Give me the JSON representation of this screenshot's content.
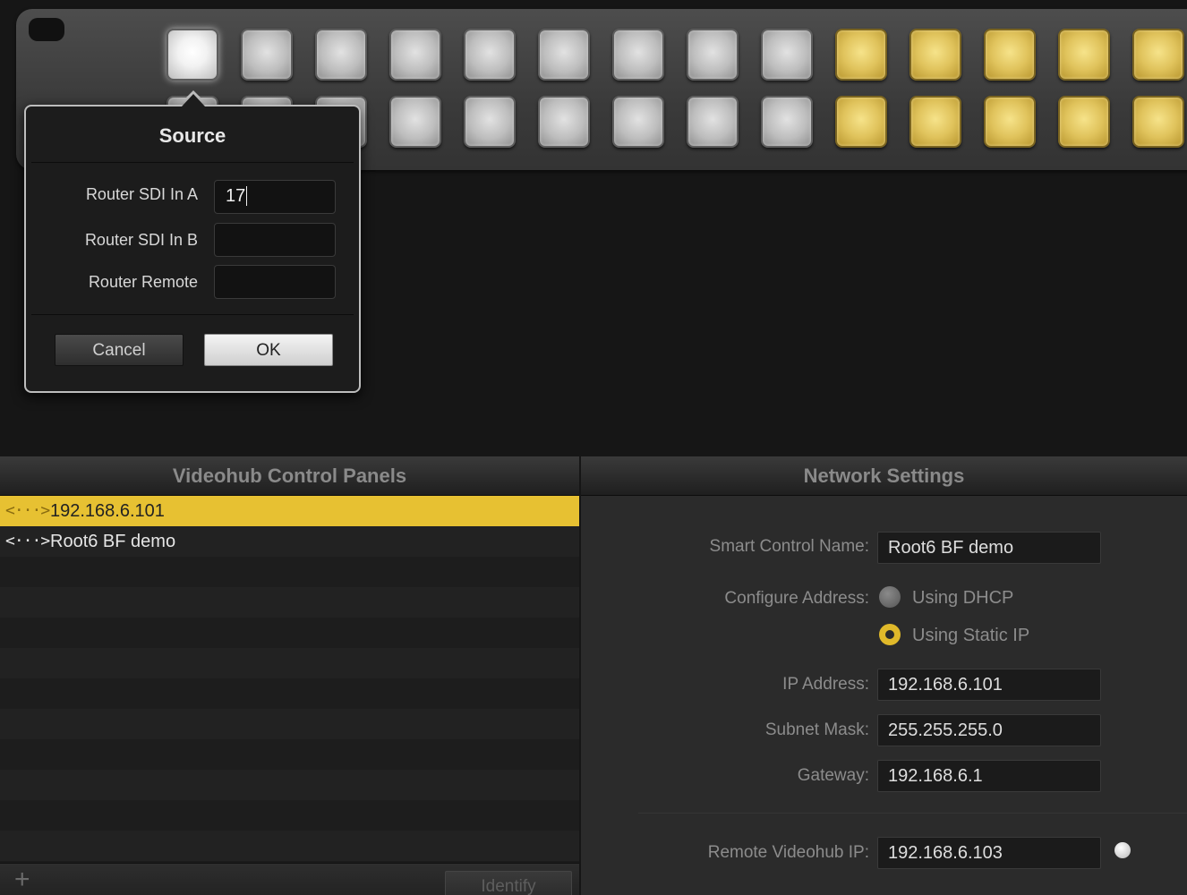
{
  "dialog": {
    "title": "Source",
    "fields": [
      {
        "label": "Router SDI In A",
        "value": "17"
      },
      {
        "label": "Router SDI In B",
        "value": ""
      },
      {
        "label": "Router Remote",
        "value": ""
      }
    ],
    "cancel_label": "Cancel",
    "ok_label": "OK"
  },
  "left_pane": {
    "title": "Videohub Control Panels",
    "items": [
      {
        "label": "192.168.6.101",
        "icon": "network-arrows-icon",
        "selected": true
      },
      {
        "label": "Root6 BF demo",
        "icon": "network-arrows-icon",
        "selected": false
      }
    ],
    "add_label": "+",
    "identify_label": "Identify"
  },
  "network": {
    "title": "Network Settings",
    "name_label": "Smart Control Name:",
    "name_value": "Root6 BF demo",
    "configure_label": "Configure Address:",
    "dhcp_label": "Using DHCP",
    "static_label": "Using Static IP",
    "ip_label": "IP Address:",
    "ip_value": "192.168.6.101",
    "subnet_label": "Subnet Mask:",
    "subnet_value": "255.255.255.0",
    "gateway_label": "Gateway:",
    "gateway_value": "192.168.6.1",
    "remote_label": "Remote Videohub IP:",
    "remote_value": "192.168.6.103"
  },
  "icons": {
    "row_icon_glyph": "<···>"
  },
  "colors": {
    "selection": "#e7c132",
    "key_gold": "#e0c35c"
  }
}
